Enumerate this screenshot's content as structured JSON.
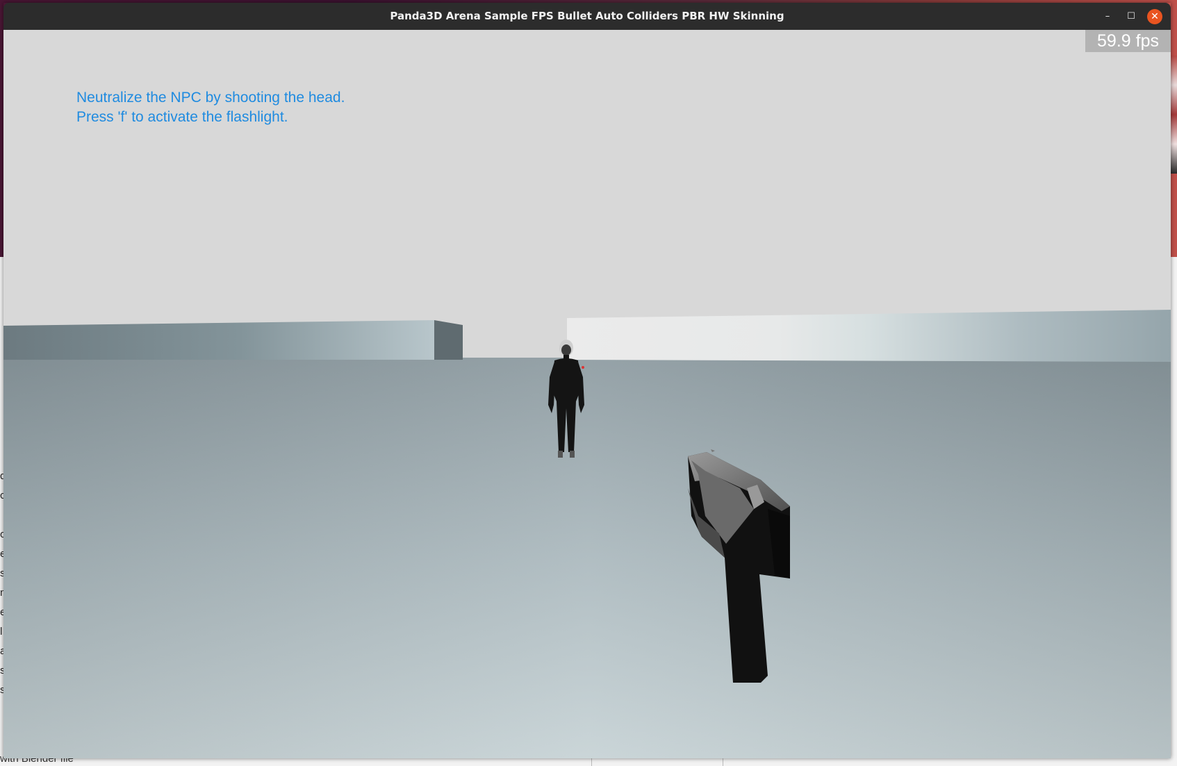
{
  "window": {
    "title": "Panda3D Arena Sample FPS Bullet Auto Colliders PBR HW Skinning",
    "minimize_glyph": "–",
    "maximize_glyph": "☐",
    "close_glyph": "✕"
  },
  "hud": {
    "instruction_line1": "Neutralize the NPC by shooting the head.",
    "instruction_line2": "Press 'f' to activate the flashlight.",
    "fps": "59.9 fps"
  },
  "scene": {
    "sky_color": "#d9d9d9",
    "ground_color": "#a9b6bb",
    "wall_left_color": "#7d8b91",
    "wall_right_color": "#e6e8e8",
    "npc_color": "#111111",
    "weapon": "pistol",
    "npc": "humanoid-npc"
  },
  "desktop": {
    "footer_text": "with Blender file",
    "edge_letters": [
      "d",
      "c",
      "",
      "ot",
      "e",
      "s",
      "n",
      "e",
      "l",
      "a",
      "s",
      "si"
    ]
  }
}
